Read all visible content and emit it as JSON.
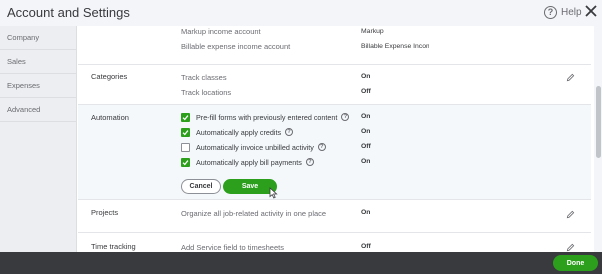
{
  "header": {
    "title": "Account and Settings",
    "help_label": "Help",
    "help_icon": "question-circle-icon",
    "close_icon": "close-icon"
  },
  "sidebar": {
    "items": [
      {
        "label": "Company"
      },
      {
        "label": "Sales"
      },
      {
        "label": "Expenses"
      },
      {
        "label": "Advanced",
        "selected": true
      }
    ]
  },
  "main": {
    "top_rows": [
      {
        "desc": "Markup income account",
        "value": "Markup"
      },
      {
        "desc": "Billable expense income account",
        "value": "Billable Expense Income"
      }
    ],
    "categories": {
      "label": "Categories",
      "rows": [
        {
          "desc": "Track classes",
          "value": "On"
        },
        {
          "desc": "Track locations",
          "value": "Off"
        }
      ]
    },
    "automation": {
      "label": "Automation",
      "options": [
        {
          "label": "Pre-fill forms with previously entered content",
          "checked": true,
          "value": "On"
        },
        {
          "label": "Automatically apply credits",
          "checked": true,
          "value": "On"
        },
        {
          "label": "Automatically invoice unbilled activity",
          "checked": false,
          "value": "Off"
        },
        {
          "label": "Automatically apply bill payments",
          "checked": true,
          "value": "On"
        }
      ],
      "cancel_label": "Cancel",
      "save_label": "Save"
    },
    "projects": {
      "label": "Projects",
      "desc": "Organize all job-related activity in one place",
      "value": "On"
    },
    "time_tracking": {
      "label": "Time tracking",
      "desc": "Add Service field to timesheets",
      "value": "Off"
    }
  },
  "footer": {
    "done_label": "Done"
  },
  "colors": {
    "accent": "#2ca01c",
    "footer_bg": "#393a3d",
    "sidebar_bg": "#eceef1",
    "automation_bg": "#f4f8fb"
  }
}
